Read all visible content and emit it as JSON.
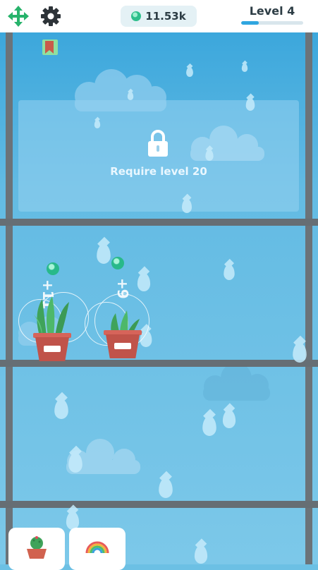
{
  "header": {
    "move_icon": "move-arrows-icon",
    "settings_icon": "gear-icon",
    "currency": {
      "value": "11.53k",
      "icon": "gem-icon"
    },
    "level": {
      "label": "Level 4",
      "progress": 0.28
    }
  },
  "locked_slot": {
    "icon": "lock-icon",
    "text": "Require level 20"
  },
  "plants": [
    {
      "name": "snake-plant",
      "counter": "+11"
    },
    {
      "name": "aloe-plant",
      "counter": "+9"
    }
  ],
  "inventory": [
    {
      "name": "cactus-card",
      "icon": "cactus-pot-icon"
    },
    {
      "name": "rainbow-card",
      "icon": "rainbow-icon"
    }
  ],
  "colors": {
    "accent": "#2fa6e0",
    "gem": "#2fbf8c",
    "pot": "#c0534a",
    "sky": "#63bbe3"
  }
}
